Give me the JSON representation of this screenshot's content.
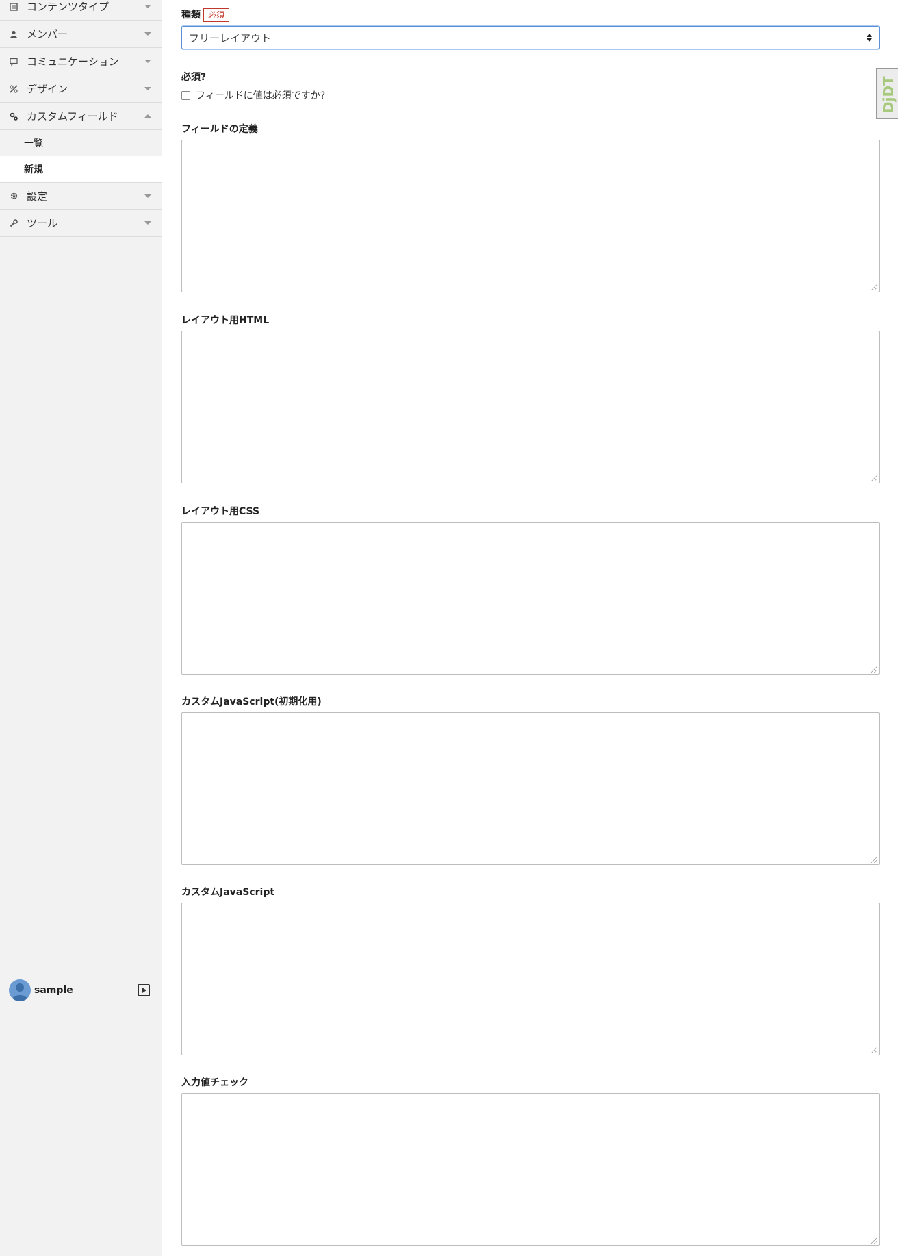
{
  "sidebar": {
    "items": [
      {
        "label": "コンテンツタイプ",
        "icon": "content-type-icon"
      },
      {
        "label": "メンバー",
        "icon": "user-icon"
      },
      {
        "label": "コミュニケーション",
        "icon": "comment-icon"
      },
      {
        "label": "デザイン",
        "icon": "design-icon"
      },
      {
        "label": "カスタムフィールド",
        "icon": "custom-field-icon"
      },
      {
        "label": "設定",
        "icon": "gear-icon"
      },
      {
        "label": "ツール",
        "icon": "wrench-icon"
      }
    ],
    "subitems": [
      {
        "label": "一覧"
      },
      {
        "label": "新規"
      }
    ],
    "user": {
      "name": "sample"
    }
  },
  "form": {
    "type_label": "種類",
    "required_badge": "必須",
    "type_value": "フリーレイアウト",
    "required_label": "必須?",
    "required_checkbox_label": "フィールドに値は必須ですか?",
    "fields": [
      {
        "label": "フィールドの定義"
      },
      {
        "label": "レイアウト用HTML"
      },
      {
        "label": "レイアウト用CSS"
      },
      {
        "label": "カスタムJavaScript(初期化用)"
      },
      {
        "label": "カスタムJavaScript"
      },
      {
        "label": "入力値チェック"
      }
    ]
  },
  "debug_toolbar": {
    "label": "DjDT"
  },
  "colors": {
    "sidebar_bg": "#f2f2f2",
    "badge": "#c0392b",
    "focus": "#5b8fd6"
  }
}
